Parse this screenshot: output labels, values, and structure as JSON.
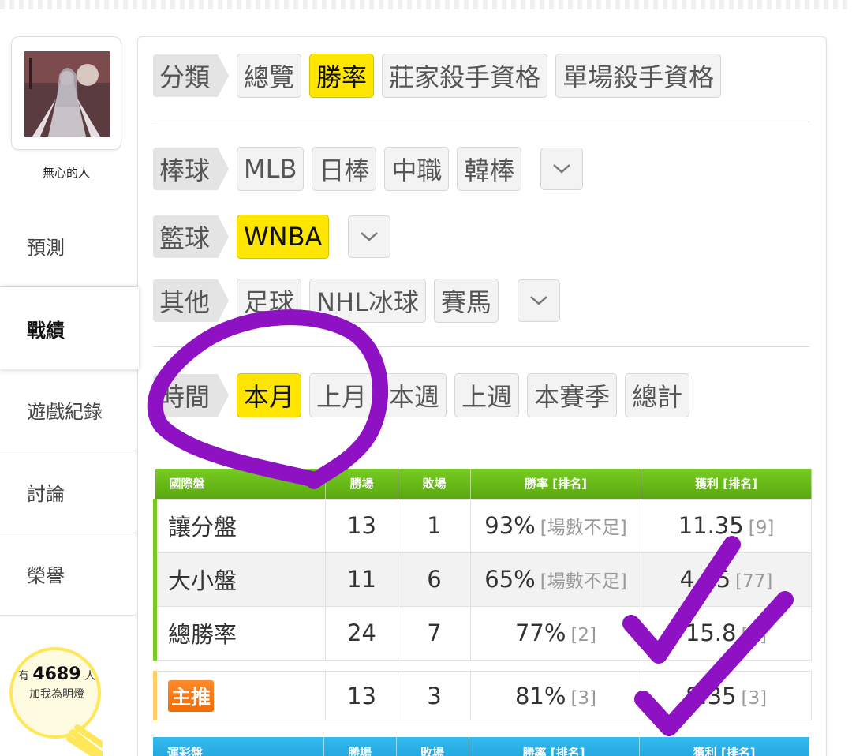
{
  "profile": {
    "username": "無心的人"
  },
  "nav": {
    "items": [
      {
        "label": "預測"
      },
      {
        "label": "戰績"
      },
      {
        "label": "遊戲紀錄"
      },
      {
        "label": "討論"
      },
      {
        "label": "榮譽"
      }
    ]
  },
  "lamp": {
    "prefix": "有",
    "count": "4689",
    "suffix": "人",
    "sub": "加我為明燈"
  },
  "filters": {
    "category": {
      "label": "分類",
      "options": [
        "總覽",
        "勝率",
        "莊家殺手資格",
        "單場殺手資格"
      ],
      "selected": "勝率"
    },
    "baseball": {
      "label": "棒球",
      "options": [
        "MLB",
        "日棒",
        "中職",
        "韓棒"
      ]
    },
    "basketball": {
      "label": "籃球",
      "options": [
        "WNBA"
      ],
      "selected": "WNBA"
    },
    "other": {
      "label": "其他",
      "options": [
        "足球",
        "NHL冰球",
        "賽馬"
      ]
    },
    "period": {
      "label": "時間",
      "options": [
        "本月",
        "上月",
        "本週",
        "上週",
        "本賽季",
        "總計"
      ],
      "selected": "本月"
    }
  },
  "international_table": {
    "headers": [
      "國際盤",
      "勝場",
      "敗場",
      "勝率 [排名]",
      "獲利 [排名]"
    ],
    "rows": [
      {
        "type": "讓分盤",
        "wins": "13",
        "losses": "1",
        "rate": "93%",
        "rate_rank": "[場數不足]",
        "profit": "11.35",
        "profit_rank": "[9]"
      },
      {
        "type": "大小盤",
        "wins": "11",
        "losses": "6",
        "rate": "65%",
        "rate_rank": "[場數不足]",
        "profit": "4.15",
        "profit_rank": "[77]"
      },
      {
        "type": "總勝率",
        "wins": "24",
        "losses": "7",
        "rate": "77%",
        "rate_rank": "[2]",
        "profit": "15.8",
        "profit_rank": "[5]"
      }
    ],
    "featured": {
      "badge": "主推",
      "wins": "13",
      "losses": "3",
      "rate": "81%",
      "rate_rank": "[3]",
      "profit": "8.35",
      "profit_rank": "[3]"
    }
  },
  "lottery_table": {
    "headers": [
      "運彩盤",
      "勝場",
      "敗場",
      "勝率 [排名]",
      "獲利 [排名]"
    ]
  },
  "colors": {
    "selected_chip": "#ffe600",
    "green_header": "#66bb11",
    "blue_header": "#22aaee",
    "badge": "#f57a0e",
    "annotation": "#8e12c4"
  }
}
